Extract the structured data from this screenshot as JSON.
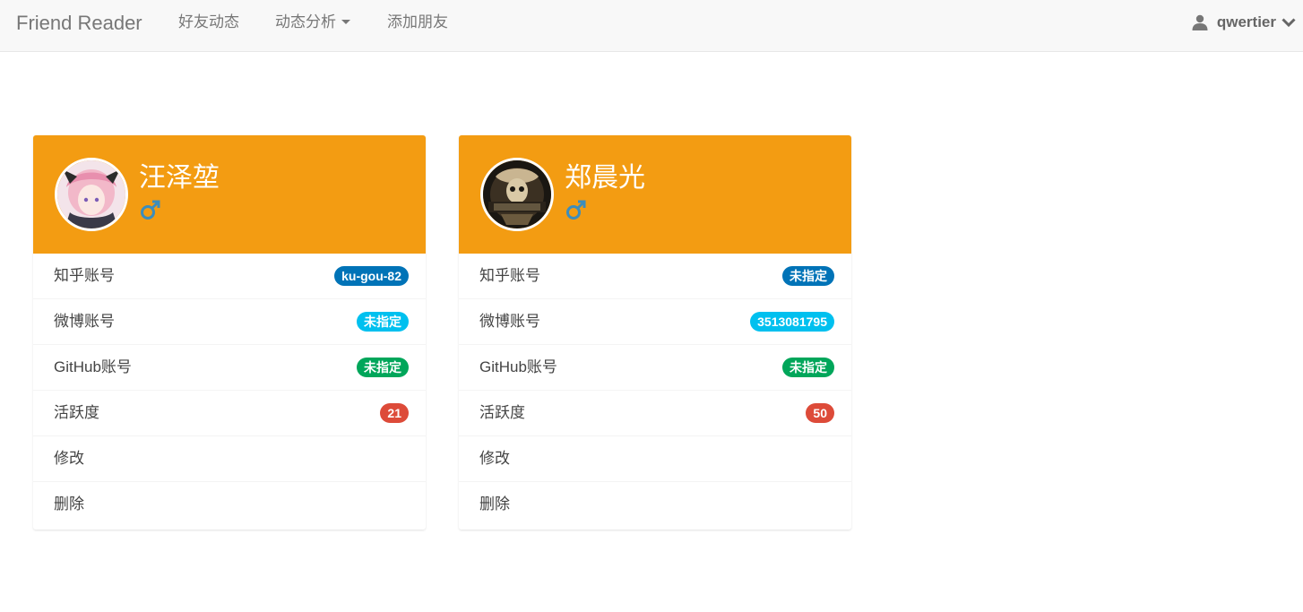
{
  "navbar": {
    "brand": "Friend Reader",
    "links": [
      {
        "label": "好友动态"
      },
      {
        "label": "动态分析"
      },
      {
        "label": "添加朋友"
      }
    ],
    "user": {
      "name": "qwertier"
    }
  },
  "colors": {
    "header": "#f39c12",
    "badge_zhihu": "#0073b7",
    "badge_weibo": "#00c0ef",
    "badge_github": "#00a65a",
    "badge_activity": "#dd4b39",
    "gender_male": "#3c8dbc"
  },
  "cards": [
    {
      "name": "汪泽堃",
      "gender_icon": "male-icon",
      "rows": [
        {
          "label": "知乎账号",
          "badge": "ku-gou-82"
        },
        {
          "label": "微博账号",
          "badge": "未指定"
        },
        {
          "label": "GitHub账号",
          "badge": "未指定"
        },
        {
          "label": "活跃度",
          "badge": "21"
        },
        {
          "label": "修改"
        },
        {
          "label": "删除"
        }
      ]
    },
    {
      "name": "郑晨光",
      "gender_icon": "male-icon",
      "rows": [
        {
          "label": "知乎账号",
          "badge": "未指定"
        },
        {
          "label": "微博账号",
          "badge": "3513081795"
        },
        {
          "label": "GitHub账号",
          "badge": "未指定"
        },
        {
          "label": "活跃度",
          "badge": "50"
        },
        {
          "label": "修改"
        },
        {
          "label": "删除"
        }
      ]
    }
  ]
}
